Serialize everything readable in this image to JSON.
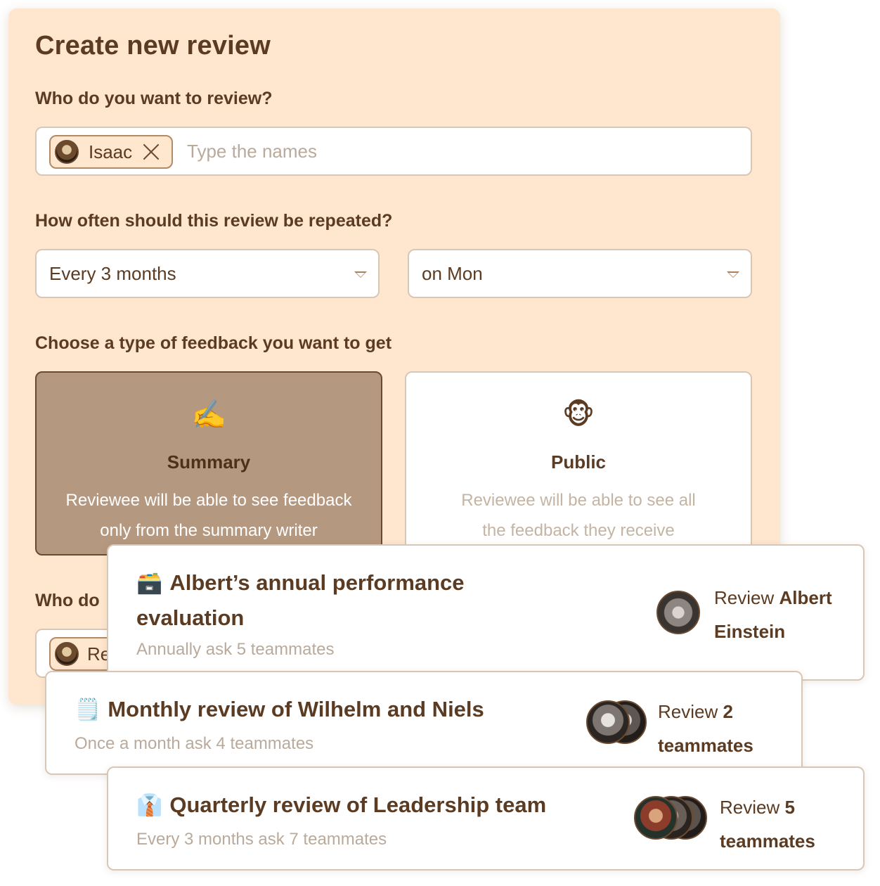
{
  "form": {
    "title": "Create new review",
    "who_label": "Who do you want to review?",
    "reviewee_chip": "Isaac",
    "names_placeholder": "Type the names",
    "repeat_label": "How often should this review be repeated?",
    "frequency_value": "Every 3 months",
    "day_value": "on Mon",
    "feedback_label": "Choose a type of feedback you want to get",
    "feedback_types": [
      {
        "emoji": "✍️",
        "title": "Summary",
        "desc_line1": "Reviewee will be able to see feedback",
        "desc_line2": "only from the summary writer",
        "selected": true
      },
      {
        "emoji": "🐵",
        "title": "Public",
        "desc_line1": "Reviewee will be able to see all",
        "desc_line2": "the feedback they receive",
        "selected": false
      }
    ],
    "next_label_partial": "Who do",
    "next_chip_partial": "Re"
  },
  "reviews": [
    {
      "emoji": "🗃️",
      "title_line1": "Albert’s annual performance",
      "title_line2": "evaluation",
      "subtitle": "Annually ask 5 teammates",
      "right_prefix": "Review",
      "right_bold": "Albert Einstein"
    },
    {
      "emoji": "🗒️",
      "title_line1": "Monthly review of Wilhelm and Niels",
      "subtitle": "Once a month ask 4 teammates",
      "right_prefix": "Review",
      "right_bold_1": "2",
      "right_bold_2": "teammates"
    },
    {
      "emoji": "👔",
      "title_line1": "Quarterly review of Leadership team",
      "subtitle": "Every 3 months ask 7 teammates",
      "right_prefix": "Review",
      "right_bold_1": "5",
      "right_bold_2": "teammates"
    }
  ],
  "colors": {
    "panel_bg": "#fee6cf",
    "text_brown": "#5b3b22",
    "selected_card_bg": "#b59880",
    "muted_text": "#b9aa9c"
  }
}
